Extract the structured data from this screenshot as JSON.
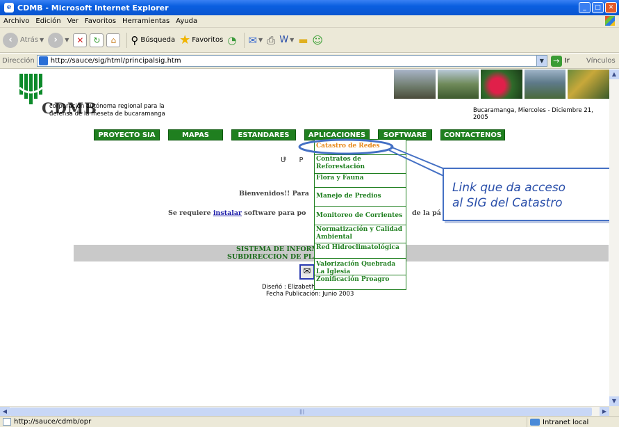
{
  "window": {
    "title": "CDMB - Microsoft Internet Explorer",
    "ie_icon": "ie-icon"
  },
  "menu": [
    "Archivo",
    "Edición",
    "Ver",
    "Favoritos",
    "Herramientas",
    "Ayuda"
  ],
  "toolbar": {
    "back": "Atrás",
    "search": "Búsqueda",
    "favorites": "Favoritos"
  },
  "address": {
    "label": "Dirección",
    "url": "http://sauce/sig/html/principalsig.htm",
    "go": "Ir",
    "links": "Vínculos"
  },
  "page": {
    "logo": "CDMB",
    "subtitle1": "corporación autónoma regional para la",
    "subtitle2": "defensa de la meseta de bucaramanga",
    "date": "Bucaramanga, Miercoles - Diciembre 21, 2005",
    "nav": [
      "PROYECTO SIA",
      "MAPAS",
      "ESTANDARES",
      "APLICACIONES",
      "SOFTWARE",
      "CONTACTENOS"
    ],
    "dropdown": [
      "Catastro de Redes",
      "Contratos de Reforestación",
      "Flora y Fauna",
      "Manejo de Predios",
      "Monitoreo de Corrientes",
      "Normatización y Calidad Ambiental",
      "Red Hidroclimatológica",
      "Valorización Quebrada La Iglesia",
      "Zonificación Proagro"
    ],
    "up_text": "U P",
    "up_small": "R",
    "welcome": "Bienvenidos!! Para",
    "requires": "Se requiere",
    "install_link": "instalar",
    "requires_rest": "software para po",
    "requires_end": "de la pá",
    "system1": "SISTEMA DE INFORM",
    "system2": "SUBDIRECCION DE PLAN",
    "design": "Diseñó : Elizabeth Cepeda Espitia",
    "publication": "Fecha Publicación: Junio 2003"
  },
  "callout": {
    "line1": "Link que da acceso",
    "line2": "al SIG del Catastro"
  },
  "status": {
    "url": "http://sauce/cdmb/opr",
    "zone": "Intranet local"
  },
  "colors": {
    "title_blue": "#0a55d0",
    "nav_green": "#1f7f1f",
    "menu_orange": "#e8891a",
    "callout_blue": "#4470c4"
  }
}
